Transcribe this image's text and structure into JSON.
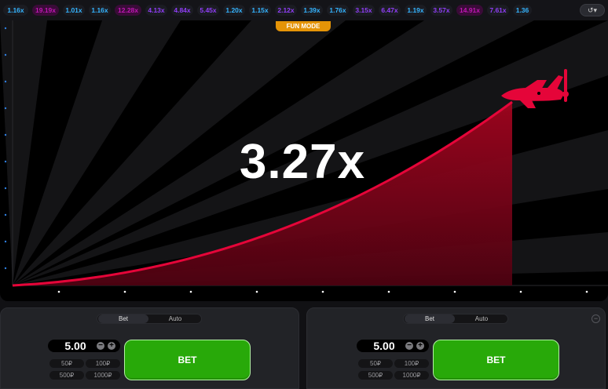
{
  "history": {
    "coefficients": [
      {
        "value": "1.16x",
        "tone": "blue"
      },
      {
        "value": "19.19x",
        "tone": "pink"
      },
      {
        "value": "1.01x",
        "tone": "blue"
      },
      {
        "value": "1.16x",
        "tone": "blue"
      },
      {
        "value": "12.28x",
        "tone": "pink"
      },
      {
        "value": "4.13x",
        "tone": "purple"
      },
      {
        "value": "4.84x",
        "tone": "purple"
      },
      {
        "value": "5.45x",
        "tone": "purple"
      },
      {
        "value": "1.20x",
        "tone": "blue"
      },
      {
        "value": "1.15x",
        "tone": "blue"
      },
      {
        "value": "2.12x",
        "tone": "purple"
      },
      {
        "value": "1.39x",
        "tone": "blue"
      },
      {
        "value": "1.76x",
        "tone": "blue"
      },
      {
        "value": "3.15x",
        "tone": "purple"
      },
      {
        "value": "6.47x",
        "tone": "purple"
      },
      {
        "value": "1.19x",
        "tone": "blue"
      },
      {
        "value": "3.57x",
        "tone": "purple"
      },
      {
        "value": "14.91x",
        "tone": "pink"
      },
      {
        "value": "7.61x",
        "tone": "purple"
      },
      {
        "value": "1.36",
        "tone": "blue"
      }
    ],
    "history_button_icon": "history-clock-icon"
  },
  "game": {
    "mode_badge": "FUN MODE",
    "multiplier": "3.27x",
    "curve_color": "#e50539",
    "plane_icon": "plane-icon"
  },
  "panels": [
    {
      "tabs": {
        "bet": "Bet",
        "auto": "Auto"
      },
      "amount": "5.00",
      "quick": [
        "50₽",
        "100₽",
        "500₽",
        "1000₽"
      ],
      "bet_label": "BET"
    },
    {
      "tabs": {
        "bet": "Bet",
        "auto": "Auto"
      },
      "amount": "5.00",
      "quick": [
        "50₽",
        "100₽",
        "500₽",
        "1000₽"
      ],
      "bet_label": "BET",
      "remove_icon": "minus-circle-icon"
    }
  ],
  "colors": {
    "bet_green": "#28a909",
    "fun_mode_orange": "#e59407",
    "blue_coef": "#34b4ff",
    "purple_coef": "#913ef8",
    "pink_coef": "#c017b4"
  }
}
